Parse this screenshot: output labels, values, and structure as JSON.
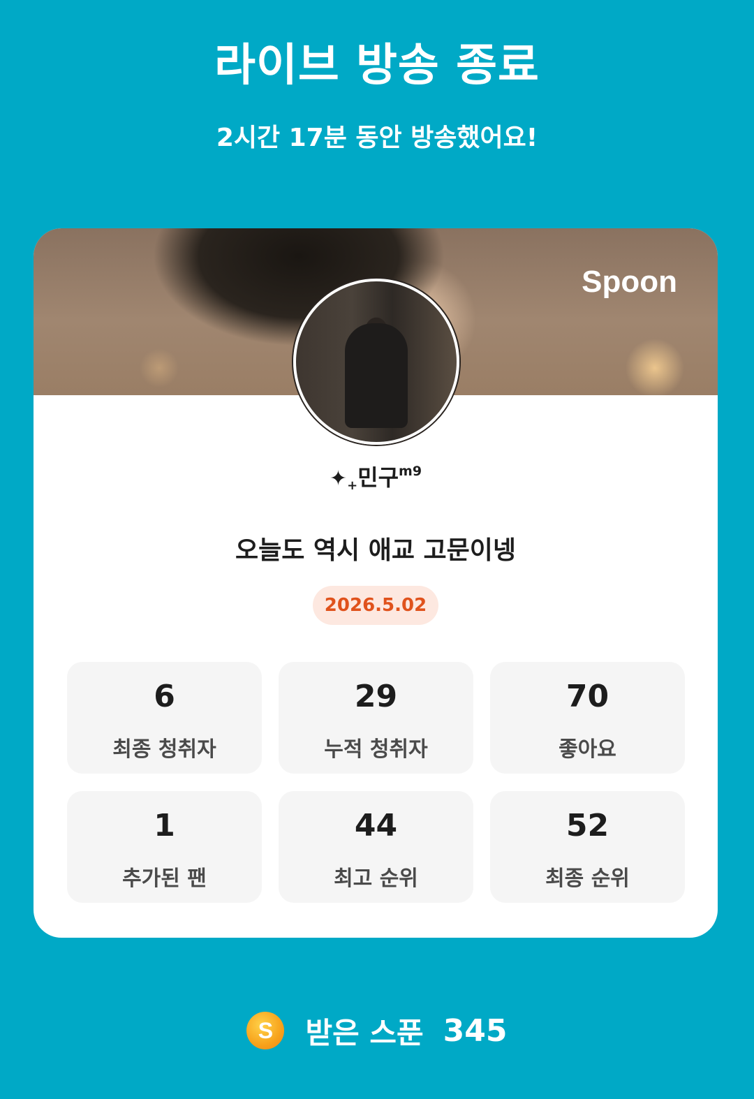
{
  "header": {
    "title": "라이브 방송 종료",
    "subtitle": "2시간 17분 동안 방송했어요!"
  },
  "card": {
    "brand": "Spoon",
    "username": {
      "prefix_glyph": "✦",
      "plus_glyph": "+",
      "name": "민구",
      "superscript": "m9"
    },
    "broadcast_title": "오늘도 역시 애교 고문이넹",
    "date": "2026.5.02",
    "stats": [
      {
        "value": "6",
        "label": "최종 청취자"
      },
      {
        "value": "29",
        "label": "누적 청취자"
      },
      {
        "value": "70",
        "label": "좋아요"
      },
      {
        "value": "1",
        "label": "추가된 팬"
      },
      {
        "value": "44",
        "label": "최고 순위"
      },
      {
        "value": "52",
        "label": "최종 순위"
      }
    ]
  },
  "spoons": {
    "icon_letter": "S",
    "label": "받은 스푼",
    "value": "345"
  },
  "colors": {
    "background": "#00a9c6",
    "date_badge_bg": "#fde8e0",
    "date_badge_text": "#e0521c",
    "stat_bg": "#f5f5f5",
    "spoon_icon": "#f7a21b"
  }
}
